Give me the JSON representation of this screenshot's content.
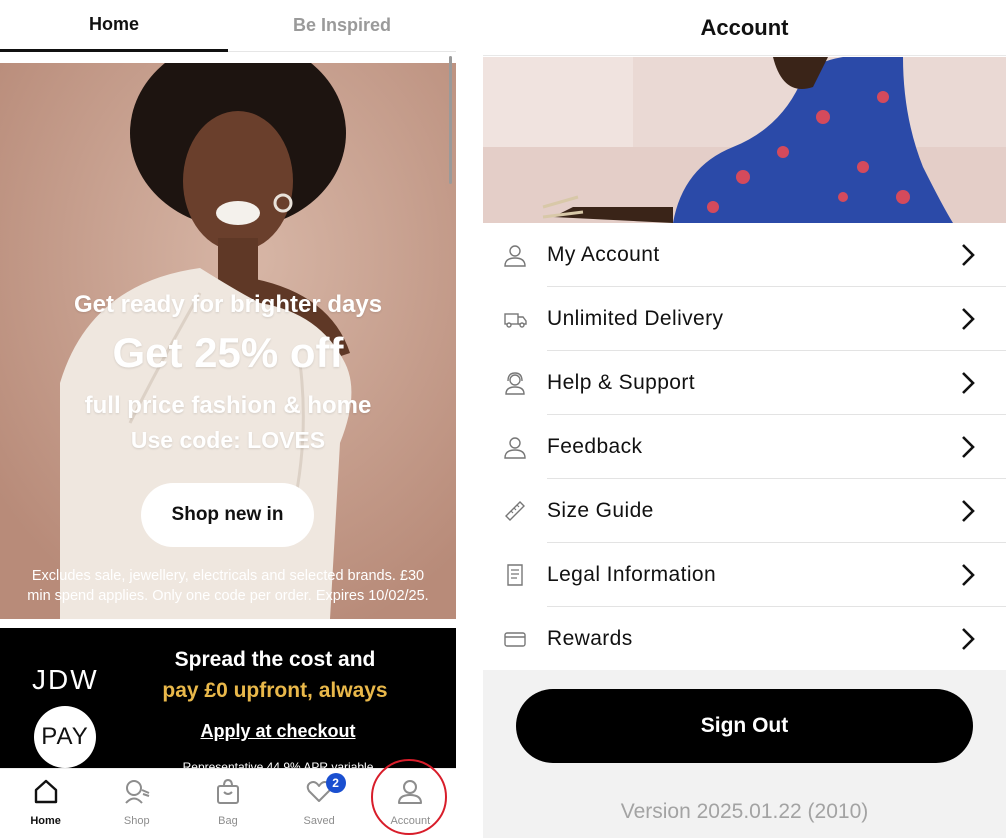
{
  "left_screen": {
    "tabs": [
      {
        "label": "Home",
        "active": true
      },
      {
        "label": "Be Inspired",
        "active": false
      }
    ],
    "hero": {
      "pre_title": "Get ready for brighter days",
      "headline": "Get 25% off",
      "subline": "full price fashion & home",
      "code_line": "Use code: LOVES",
      "button_label": "Shop new in",
      "fine_print_1": "Excludes sale, jewellery, electricals and selected brands. £30",
      "fine_print_2": "min spend applies. Only one code per order. Expires 10/02/25."
    },
    "promo": {
      "logo_top": "JDW",
      "logo_bottom": "PAY",
      "line1": "Spread the cost and",
      "line2": "pay £0 upfront, always",
      "link": "Apply at checkout",
      "small": "Representative 44.9% APR variable"
    },
    "bottom_nav": {
      "items": [
        {
          "label": "Home",
          "icon": "home-icon",
          "active": true
        },
        {
          "label": "Shop",
          "icon": "search-icon",
          "active": false
        },
        {
          "label": "Bag",
          "icon": "bag-icon",
          "active": false
        },
        {
          "label": "Saved",
          "icon": "heart-icon",
          "active": false,
          "badge": "2"
        },
        {
          "label": "Account",
          "icon": "user-icon",
          "active": false
        }
      ]
    }
  },
  "right_screen": {
    "title": "Account",
    "menu": [
      {
        "label": "My Account",
        "icon": "user-icon"
      },
      {
        "label": "Unlimited Delivery",
        "icon": "delivery-truck-icon"
      },
      {
        "label": "Help & Support",
        "icon": "support-agent-icon"
      },
      {
        "label": "Feedback",
        "icon": "user-icon"
      },
      {
        "label": "Size Guide",
        "icon": "ruler-icon"
      },
      {
        "label": "Legal Information",
        "icon": "document-icon"
      },
      {
        "label": "Rewards",
        "icon": "card-icon"
      }
    ],
    "sign_out_label": "Sign Out",
    "version": "Version 2025.01.22 (2010)"
  },
  "colors": {
    "badge_blue": "#1a4fd0",
    "promo_gold": "#e9b84a",
    "highlight_red": "#d81d2a"
  }
}
